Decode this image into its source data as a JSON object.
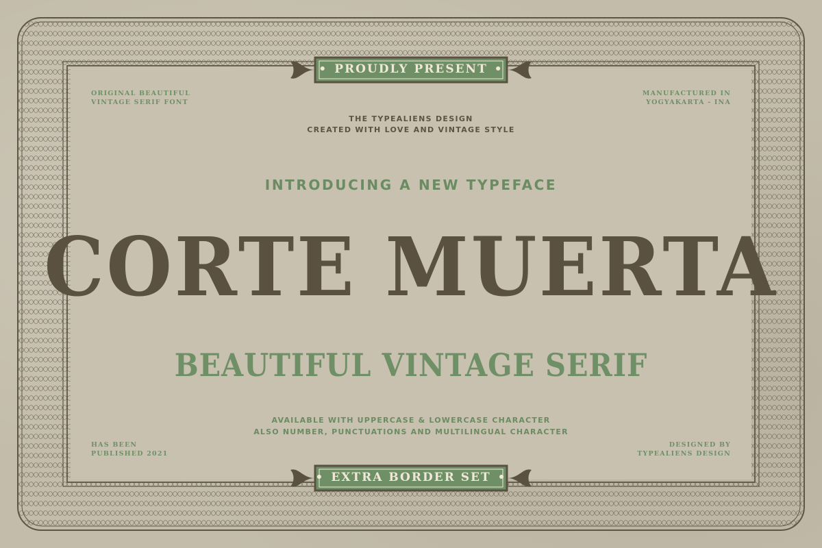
{
  "header_banner": {
    "text": "PROUDLY PRESENT"
  },
  "footer_banner": {
    "text": "EXTRA BORDER SET"
  },
  "top_left_note": [
    "ORIGINAL BEAUTIFUL",
    "VINTAGE SERIF FONT"
  ],
  "top_right_note": [
    "MANUFACTURED IN",
    "YOGYAKARTA - INA"
  ],
  "bottom_left_note": [
    "HAS BEEN",
    "PUBLISHED 2021"
  ],
  "bottom_right_note": [
    "DESIGNED BY",
    "TYPEALIENS DESIGN"
  ],
  "credit_lines": [
    "THE TYPEALIENS DESIGN",
    "CREATED WITH LOVE AND VINTAGE STYLE"
  ],
  "intro_text": "INTRODUCING A NEW TYPEFACE",
  "title": "Corte Muerta",
  "subtitle": "Beautiful Vintage Serif",
  "availability_lines": [
    "AVAILABLE WITH UPPERCASE & LOWERCASE CHARACTER",
    "ALSO NUMBER, PUNCTUATIONS AND MULTILINGUAL CHARACTER"
  ],
  "colors": {
    "background": "#c3bcaa",
    "brown": "#5a5141",
    "green": "#6f9067",
    "banner_fill": "#6f9067",
    "banner_text": "#efe8d6"
  }
}
